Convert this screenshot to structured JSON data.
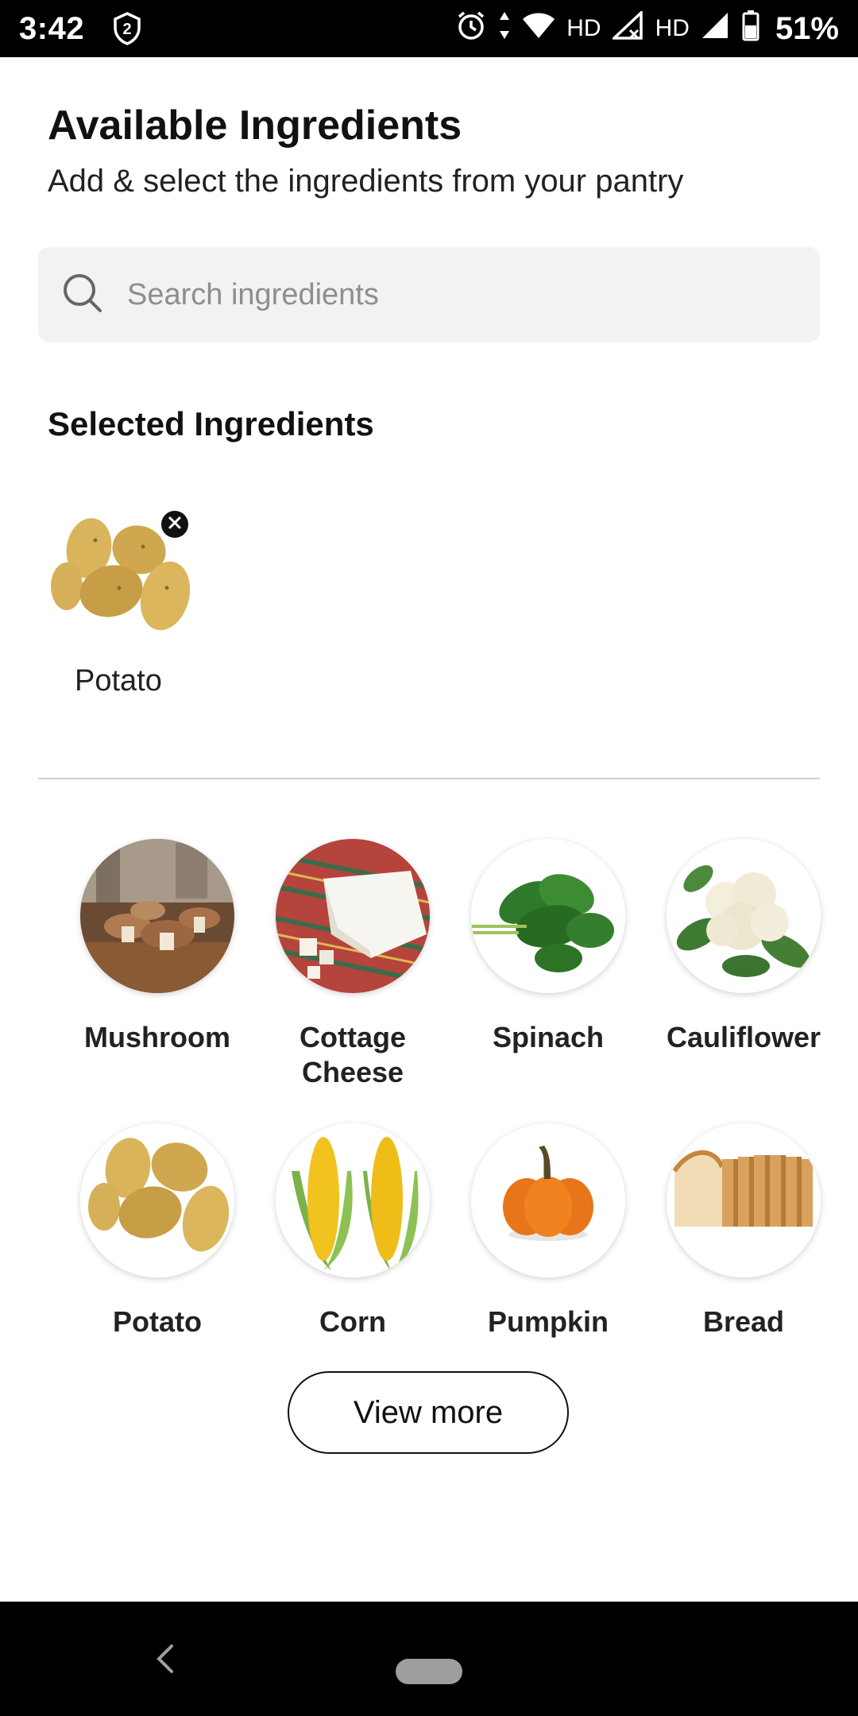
{
  "status_bar": {
    "time": "3:42",
    "badge": "2",
    "hd1": "HD",
    "hd2": "HD",
    "battery": "51%"
  },
  "header": {
    "title": "Available Ingredients",
    "subtitle": "Add & select the ingredients from your pantry"
  },
  "search": {
    "placeholder": "Search ingredients",
    "value": ""
  },
  "selected": {
    "title": "Selected Ingredients",
    "items": [
      {
        "label": "Potato",
        "icon": "potato-image"
      }
    ]
  },
  "ingredients": [
    {
      "label": "Mushroom",
      "icon": "mushroom-image"
    },
    {
      "label": "Cottage Cheese",
      "icon": "cottage-cheese-image"
    },
    {
      "label": "Spinach",
      "icon": "spinach-image"
    },
    {
      "label": "Cauliflower",
      "icon": "cauliflower-image"
    },
    {
      "label": "Potato",
      "icon": "potato-image"
    },
    {
      "label": "Corn",
      "icon": "corn-image"
    },
    {
      "label": "Pumpkin",
      "icon": "pumpkin-image"
    },
    {
      "label": "Bread",
      "icon": "bread-image"
    }
  ],
  "view_more_label": "View more",
  "colors": {
    "search_bg": "#f2f2f2",
    "divider": "#cfcfcf",
    "text": "#111111"
  }
}
